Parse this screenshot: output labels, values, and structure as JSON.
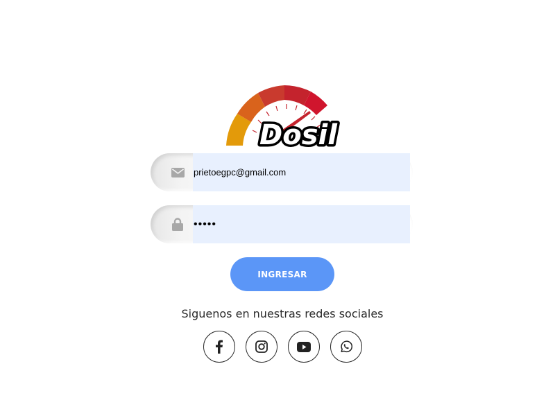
{
  "logo": {
    "text": "Dosil",
    "colors": [
      "#e39a0a",
      "#d9631c",
      "#c93a2e",
      "#c4232d",
      "#d0152d"
    ]
  },
  "login": {
    "email": {
      "icon": "envelope-icon",
      "value": "prietoegpc@gmail.com"
    },
    "password": {
      "icon": "lock-icon",
      "value": "•••••"
    },
    "submit_label": "INGRESAR"
  },
  "social": {
    "heading": "Siguenos en nuestras redes sociales",
    "links": [
      {
        "icon": "facebook-icon"
      },
      {
        "icon": "instagram-icon"
      },
      {
        "icon": "youtube-icon"
      },
      {
        "icon": "whatsapp-icon"
      }
    ]
  },
  "colors": {
    "accent": "#5b96f7",
    "input_fill": "#e8f0fe"
  }
}
